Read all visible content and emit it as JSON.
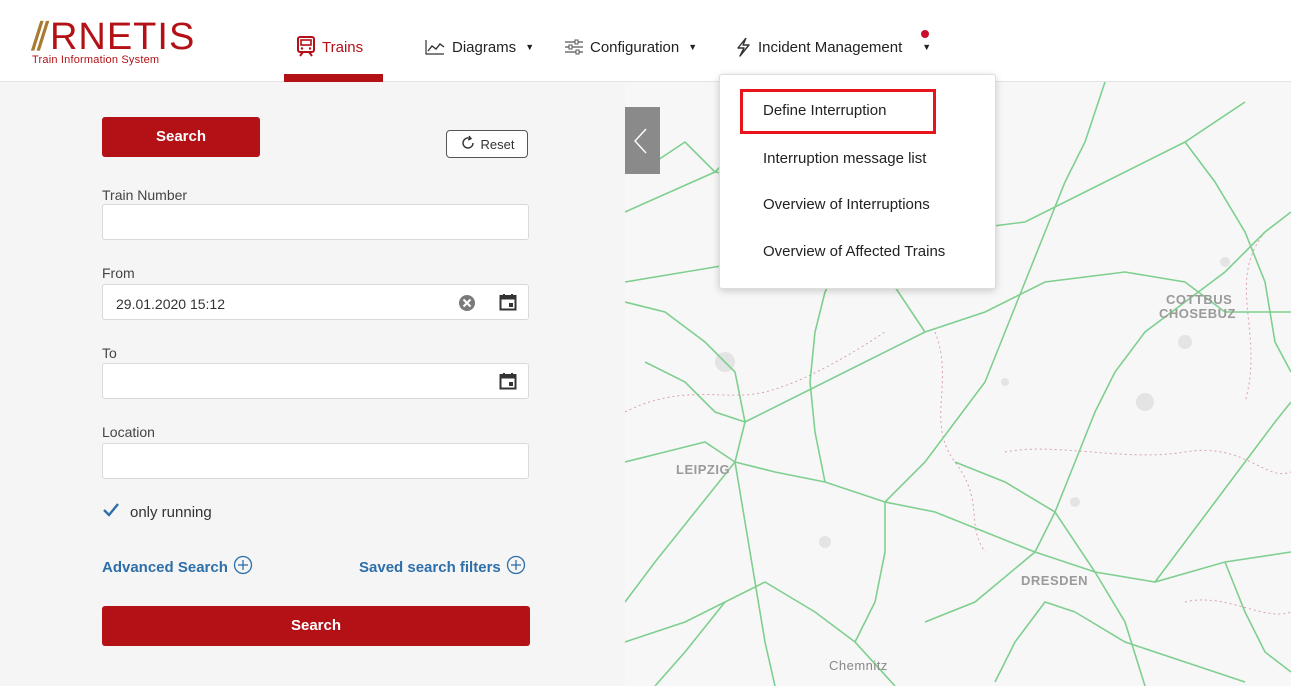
{
  "logo": {
    "wordmark_mark": "⫽",
    "wordmark": "RNETIS",
    "tagline": "Train Information System"
  },
  "nav": {
    "trains": "Trains",
    "diagrams": "Diagrams",
    "configuration": "Configuration",
    "incident": "Incident Management"
  },
  "incident_menu": [
    "Define Interruption",
    "Interruption message list",
    "Overview of Interruptions",
    "Overview of Affected Trains"
  ],
  "search_form": {
    "search_label": "Search",
    "reset_label": "Reset",
    "train_number_label": "Train Number",
    "train_number_value": "",
    "from_label": "From",
    "from_value": "29.01.2020 15:12",
    "to_label": "To",
    "to_value": "",
    "location_label": "Location",
    "location_value": "",
    "only_running_label": "only running",
    "only_running_checked": true,
    "advanced_search": "Advanced Search",
    "saved_filters": "Saved search filters"
  },
  "map": {
    "labels": {
      "cottbus": "COTTBUS",
      "chosebuz": "CHOSEBUZ",
      "leipzig": "LEIPZIG",
      "dresden": "DRESDEN",
      "chemnitz": "Chemnitz"
    }
  },
  "colors": {
    "brand": "#b31116",
    "rail_line": "#7fcf8f",
    "link": "#2e6faa",
    "highlight": "#e8141c"
  }
}
